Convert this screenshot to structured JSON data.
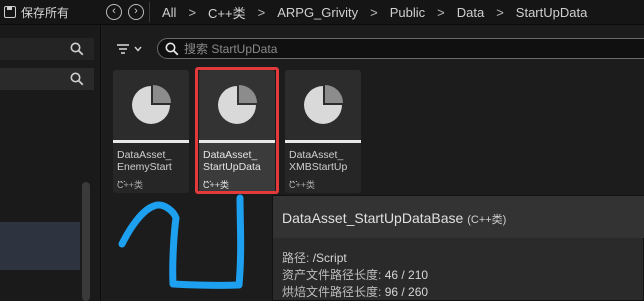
{
  "toolbar": {
    "save_all_label": "保存所有",
    "back_icon": "back-icon",
    "forward_icon": "forward-icon",
    "history_icon": "history-icon"
  },
  "breadcrumbs": [
    "All",
    "C++类",
    "ARPG_Grivity",
    "Public",
    "Data",
    "StartUpData"
  ],
  "search": {
    "placeholder": "搜索 StartUpData",
    "value": ""
  },
  "assets": [
    {
      "name": "DataAsset_\nEnemyStart\n...",
      "type": "C++类",
      "selected": false
    },
    {
      "name": "DataAsset_\nStartUpData\n...",
      "type": "C++类",
      "selected": true
    },
    {
      "name": "DataAsset_\nXMBStartUp\n...",
      "type": "C++类",
      "selected": false
    }
  ],
  "tooltip": {
    "title": "DataAsset_StartUpDataBase",
    "title_suffix": "(C++类)",
    "path_label": "路径:",
    "path_value": "/Script",
    "asset_path_label": "资产文件路径长度:",
    "asset_path_value": "46 / 210",
    "cooked_path_label": "烘焙文件路径长度:",
    "cooked_path_value": "96 / 260"
  },
  "colors": {
    "selection_outline": "#e23a3a",
    "annotation_arrow": "#1ea0f0"
  }
}
